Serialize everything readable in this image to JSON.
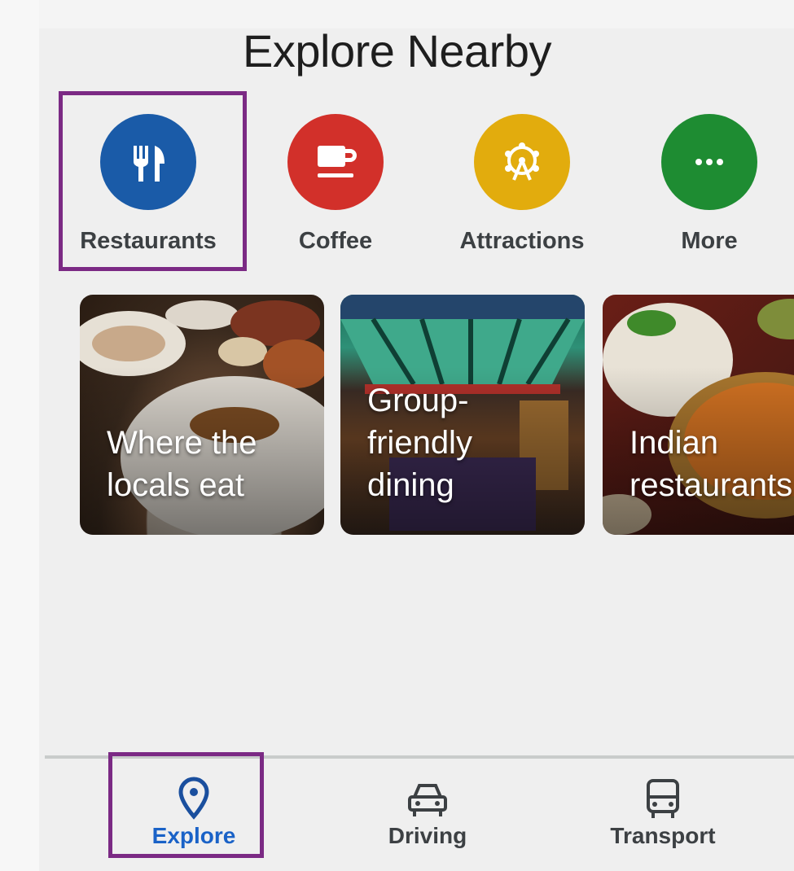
{
  "page": {
    "title": "Explore Nearby"
  },
  "categories": [
    {
      "label": "Restaurants",
      "icon": "utensils-icon",
      "color": "#1a5ba8",
      "selected": true
    },
    {
      "label": "Coffee",
      "icon": "coffee-cup-icon",
      "color": "#d2302a",
      "selected": false
    },
    {
      "label": "Attractions",
      "icon": "ferris-wheel-icon",
      "color": "#e2ac0d",
      "selected": false
    },
    {
      "label": "More",
      "icon": "more-dots-icon",
      "color": "#1e8c32",
      "selected": false
    }
  ],
  "cards": [
    {
      "title": "Where the\nlocals eat"
    },
    {
      "title": "Group-\nfriendly\ndining"
    },
    {
      "title": "Indian\nrestaurants"
    }
  ],
  "bottom_nav": [
    {
      "label": "Explore",
      "icon": "location-pin-icon",
      "active": true
    },
    {
      "label": "Driving",
      "icon": "car-icon",
      "active": false
    },
    {
      "label": "Transport",
      "icon": "bus-icon",
      "active": false
    }
  ],
  "colors": {
    "highlight": "#7b2a84",
    "active_nav": "#1a62c7"
  }
}
